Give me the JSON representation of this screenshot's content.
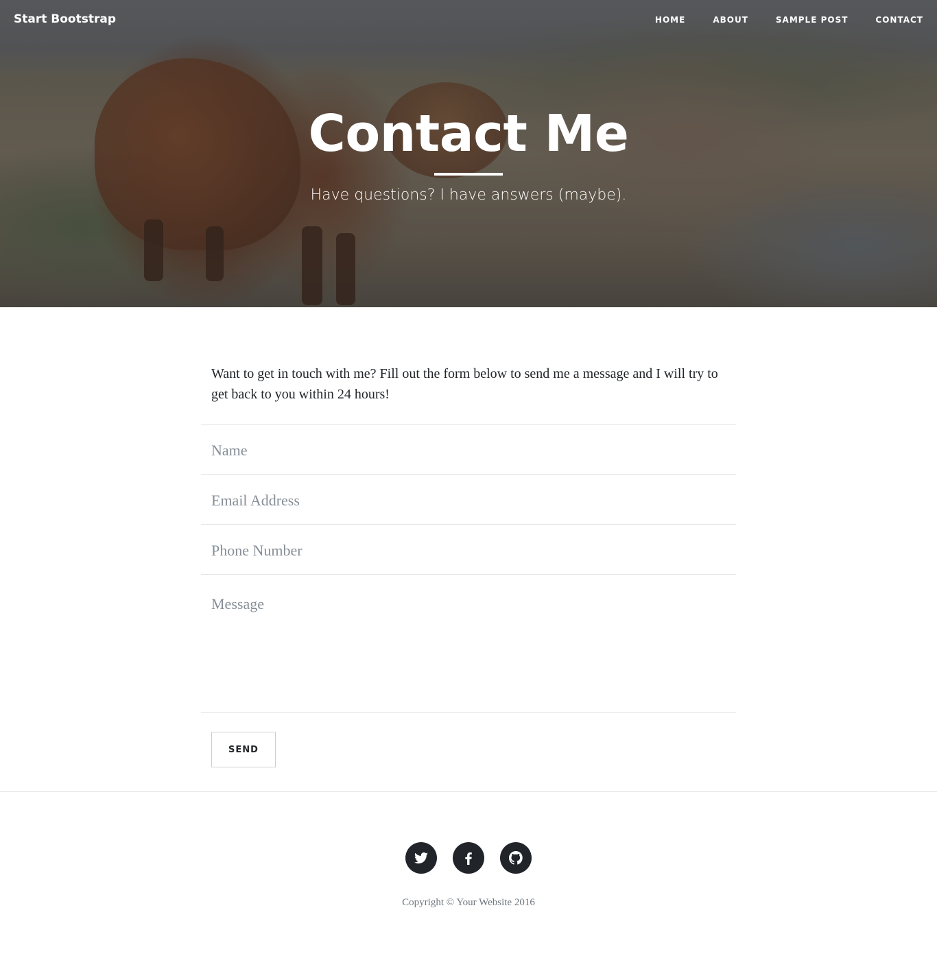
{
  "navbar": {
    "brand": "Start Bootstrap",
    "links": [
      "HOME",
      "ABOUT",
      "SAMPLE POST",
      "CONTACT"
    ]
  },
  "hero": {
    "title": "Contact Me",
    "subtitle": "Have questions? I have answers (maybe)."
  },
  "content": {
    "intro": "Want to get in touch with me? Fill out the form below to send me a message and I will try to get back to you within 24 hours!",
    "form": {
      "name_placeholder": "Name",
      "email_placeholder": "Email Address",
      "phone_placeholder": "Phone Number",
      "message_placeholder": "Message",
      "send_label": "SEND"
    }
  },
  "footer": {
    "social": [
      "twitter-icon",
      "facebook-icon",
      "github-icon"
    ],
    "copyright": "Copyright © Your Website 2016"
  },
  "colors": {
    "text": "#212529",
    "muted": "#868e96",
    "border": "#e3e3e3",
    "dark": "#212529"
  }
}
